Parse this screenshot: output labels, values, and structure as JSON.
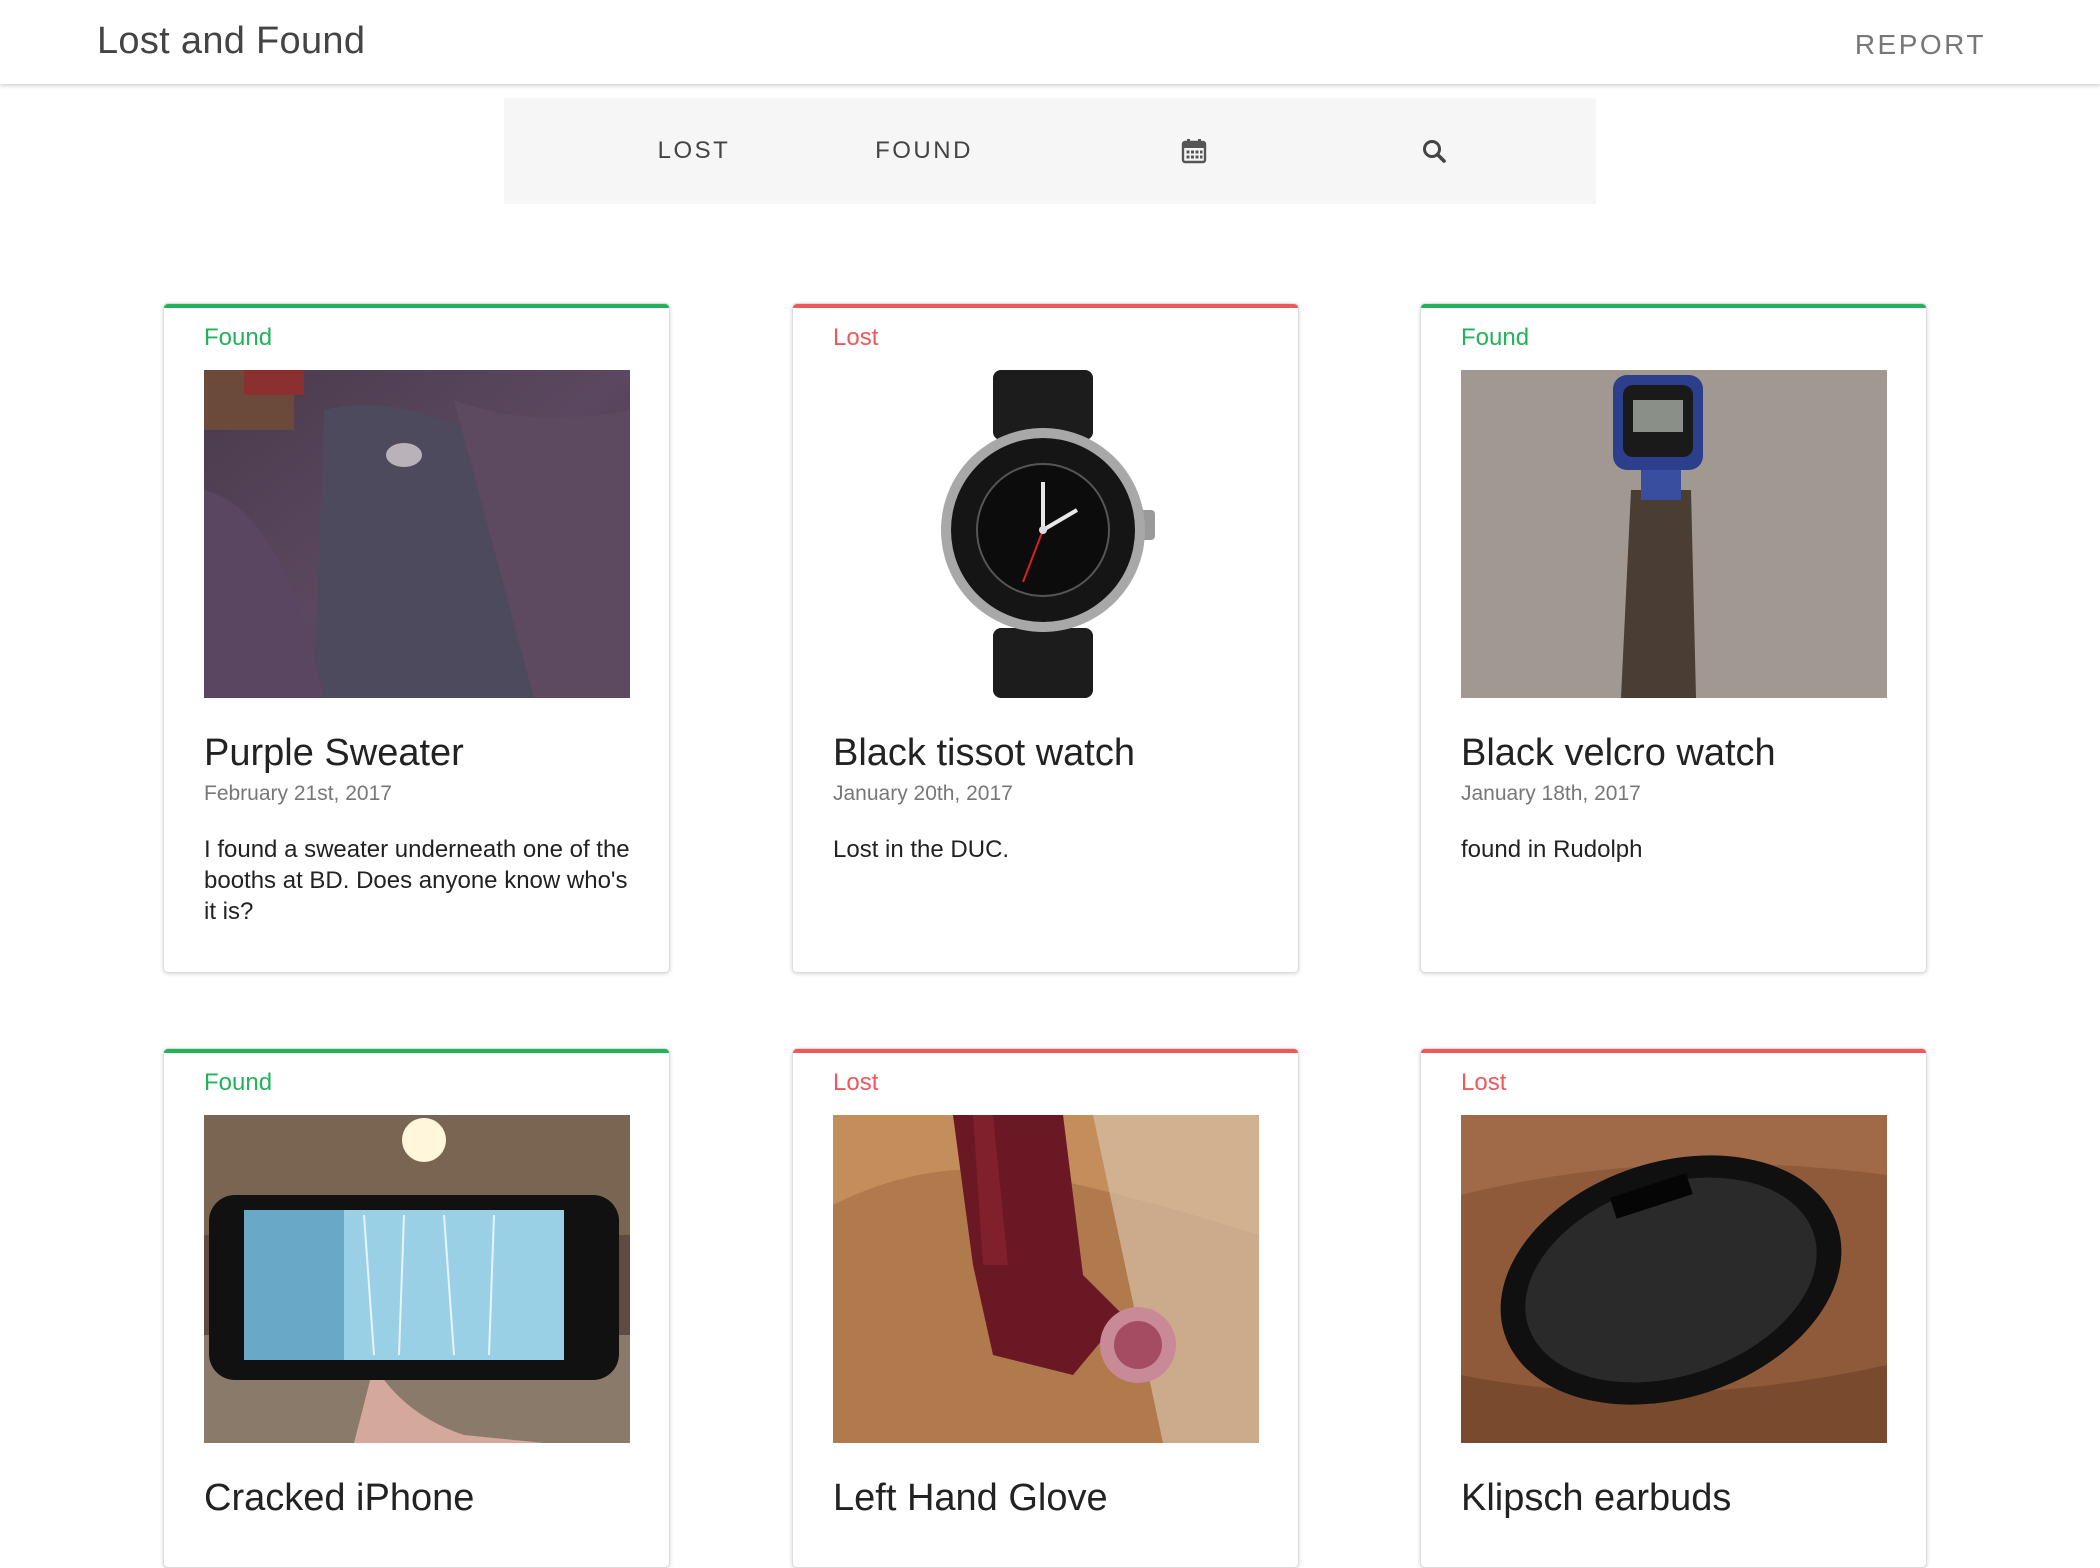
{
  "app": {
    "title": "Lost and Found",
    "report_label": "REPORT"
  },
  "filters": {
    "lost_label": "LOST",
    "found_label": "FOUND",
    "calendar_icon": "calendar-icon",
    "search_icon": "search-icon"
  },
  "colors": {
    "found": "#22b35a",
    "lost": "#f0575b"
  },
  "items": [
    {
      "status": "Found",
      "title": "Purple Sweater",
      "date": "February 21st, 2017",
      "description": "I found a sweater underneath one of the booths at BD. Does anyone know who's it is?"
    },
    {
      "status": "Lost",
      "title": "Black tissot watch",
      "date": "January 20th, 2017",
      "description": "Lost in the DUC."
    },
    {
      "status": "Found",
      "title": "Black velcro watch",
      "date": "January 18th, 2017",
      "description": "found in Rudolph"
    },
    {
      "status": "Found",
      "title": "Cracked iPhone",
      "date": "",
      "description": ""
    },
    {
      "status": "Lost",
      "title": "Left Hand Glove",
      "date": "",
      "description": ""
    },
    {
      "status": "Lost",
      "title": "Klipsch earbuds",
      "date": "",
      "description": ""
    }
  ]
}
